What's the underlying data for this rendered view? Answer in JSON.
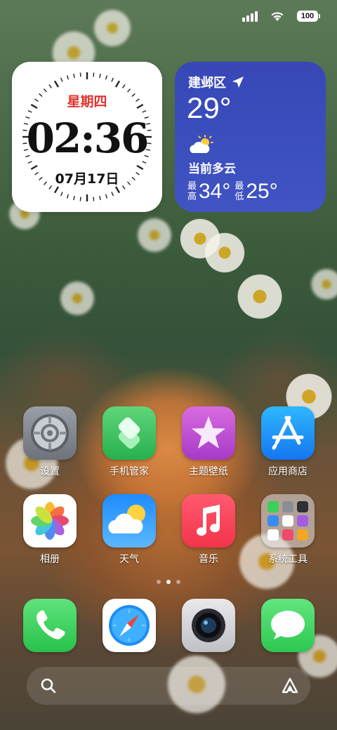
{
  "status_bar": {
    "signal_icon": "cellular-signal-icon",
    "wifi_icon": "wifi-icon",
    "battery": "100"
  },
  "clock_widget": {
    "weekday": "星期四",
    "time": "02:36",
    "date": "07月17日",
    "weekday_color": "#e0322c"
  },
  "weather_widget": {
    "location": "建邺区",
    "location_icon": "location-arrow-icon",
    "temperature": "29°",
    "condition_icon": "partly-cloudy-icon",
    "condition": "当前多云",
    "high_label": "最高",
    "high": "34°",
    "low_label": "最低",
    "low": "25°",
    "background": "#3a4cbb"
  },
  "apps": [
    {
      "label": "设置",
      "icon": "settings-gear-icon"
    },
    {
      "label": "手机管家",
      "icon": "phone-manager-icon"
    },
    {
      "label": "主题壁纸",
      "icon": "themes-star-icon"
    },
    {
      "label": "应用商店",
      "icon": "app-store-icon"
    },
    {
      "label": "相册",
      "icon": "photos-flower-icon"
    },
    {
      "label": "天气",
      "icon": "weather-cloud-sun-icon"
    },
    {
      "label": "音乐",
      "icon": "music-note-icon"
    },
    {
      "label": "系统工具",
      "icon": "folder-icon"
    }
  ],
  "page_indicator": {
    "pages": 3,
    "active": 2
  },
  "dock": [
    {
      "name": "phone",
      "icon": "phone-icon"
    },
    {
      "name": "browser",
      "icon": "safari-compass-icon"
    },
    {
      "name": "camera",
      "icon": "camera-icon"
    },
    {
      "name": "messages",
      "icon": "messages-icon"
    }
  ],
  "search_bar": {
    "left_icon": "search-icon",
    "right_icon": "assistant-icon"
  }
}
